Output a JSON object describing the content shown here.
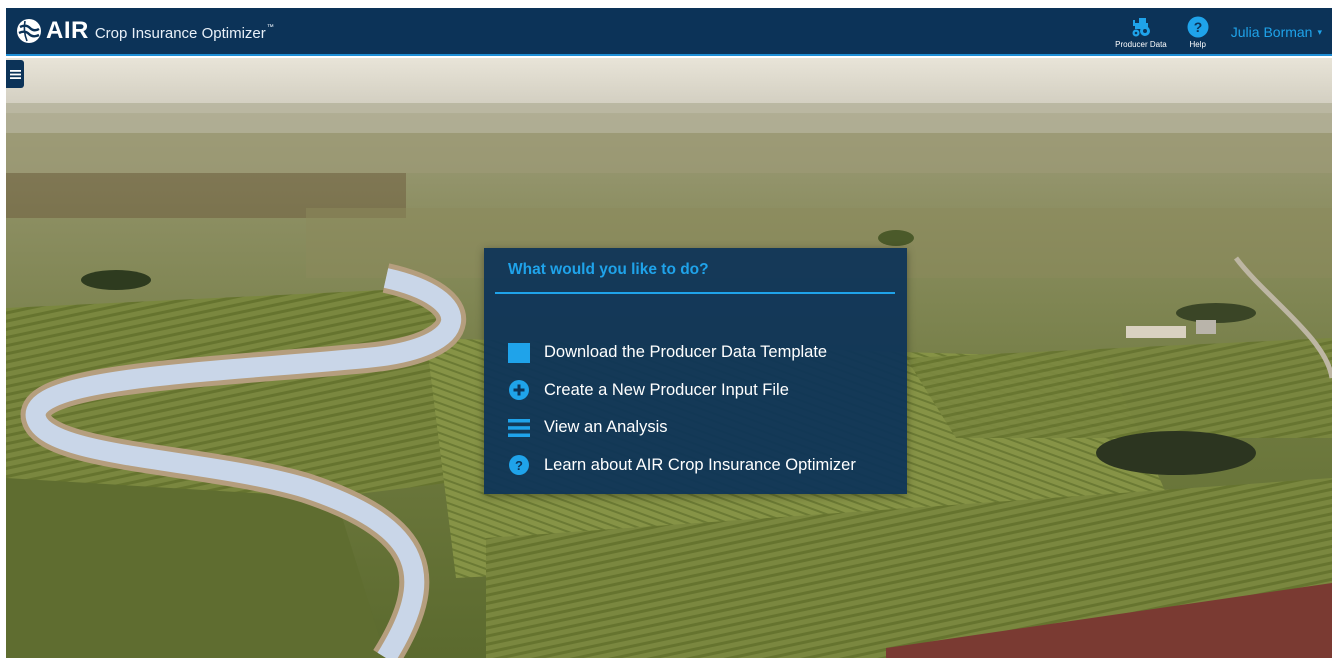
{
  "app": {
    "logo_text": "AIR",
    "product_name": "Crop Insurance Optimizer",
    "trademark": "™"
  },
  "header": {
    "producer_data_label": "Producer Data",
    "help_label": "Help",
    "user_name": "Julia Borman",
    "user_caret": "▾"
  },
  "dialog": {
    "title": "What would you like to do?",
    "actions": [
      {
        "label": "Download the Producer Data Template",
        "icon": "template-square-icon"
      },
      {
        "label": "Create a New Producer Input File",
        "icon": "plus-circle-icon"
      },
      {
        "label": "View an Analysis",
        "icon": "list-lines-icon"
      },
      {
        "label": "Learn about AIR Crop Insurance Optimizer",
        "icon": "question-circle-icon"
      }
    ]
  },
  "colors": {
    "navbar": "#0c3358",
    "accent": "#1fa3ea",
    "dialog_bg": "#0c3358"
  }
}
